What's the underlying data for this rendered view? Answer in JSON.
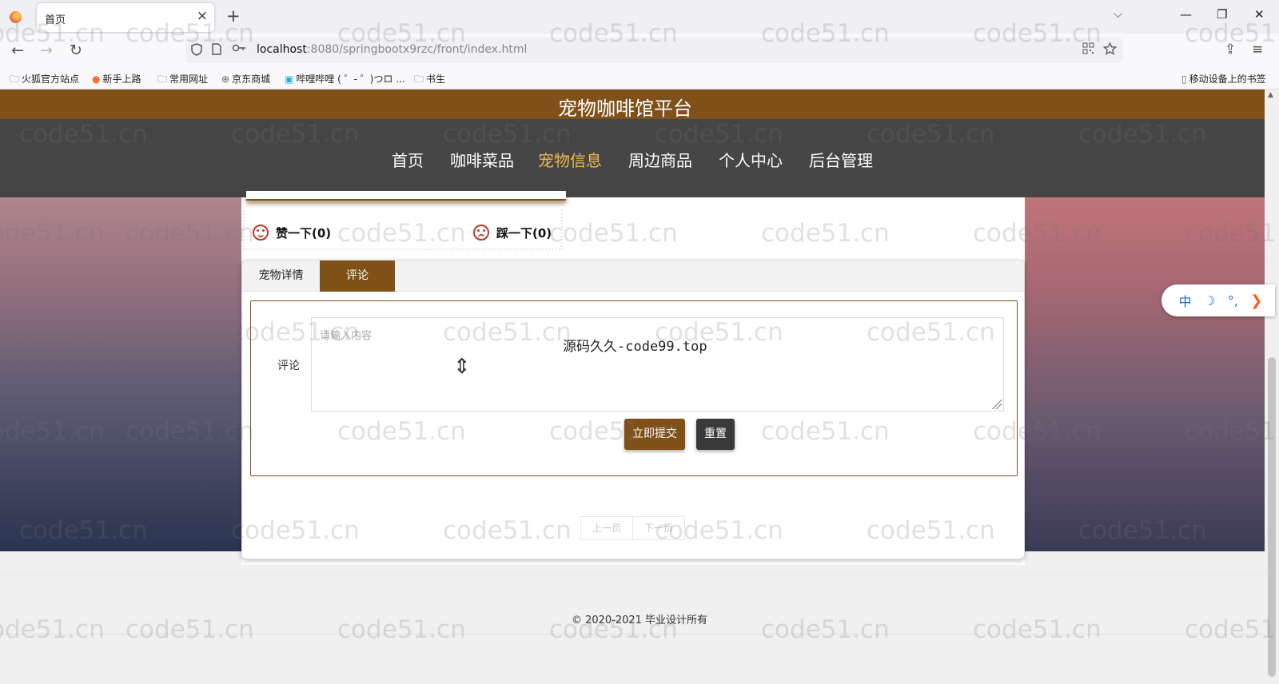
{
  "browser": {
    "tab_title": "首页",
    "close_glyph": "×",
    "new_tab_glyph": "+",
    "list_tabs_glyph": "⌵",
    "window_controls": {
      "minimize": "—",
      "restore": "❐",
      "close": "✕"
    },
    "url_host": "localhost",
    "url_rest": ":8080/springbootx9rzc/front/index.html",
    "nav_icons": {
      "back": "←",
      "forward": "→",
      "reload": "↻",
      "extensions": "⇪",
      "menu": "≡"
    },
    "bookmarks": [
      "火狐官方站点",
      "新手上路",
      "常用网址",
      "京东商城",
      "哔哩哔哩 ( ゜- ゜)つロ ...",
      "书生"
    ],
    "mobile_bookmarks": "移动设备上的书签"
  },
  "site": {
    "title": "宠物咖啡馆平台",
    "menu": [
      "首页",
      "咖啡菜品",
      "宠物信息",
      "周边商品",
      "个人中心",
      "后台管理"
    ],
    "active_menu": "宠物信息"
  },
  "detail": {
    "like_label": "赞一下(0)",
    "dislike_label": "踩一下(0)",
    "tabs": [
      "宠物详情",
      "评论"
    ],
    "active_tab": "评论",
    "comment_label": "评论",
    "comment_placeholder": "请输入内容",
    "overlay_note": "源码久久-code99.top",
    "submit_label": "立即提交",
    "reset_label": "重置",
    "pager": {
      "prev": "上一页",
      "next": "下一页"
    }
  },
  "footer": {
    "copyright": "© 2020-2021 毕业设计所有"
  },
  "ime": {
    "lang": "中",
    "moon": "☽",
    "punct": "°,",
    "arrow": "❯"
  },
  "watermark": "code51.cn",
  "colors": {
    "brand": "#7f5119",
    "menu_bg": "#454545",
    "active_menu": "#f3b84c",
    "reset_btn": "#3a3a3a"
  }
}
